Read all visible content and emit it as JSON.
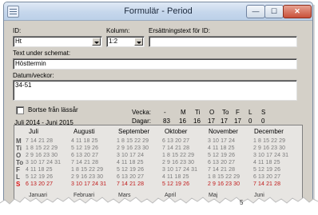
{
  "window": {
    "title": "Formulär - Period"
  },
  "controls": {
    "min": "—",
    "max": "☐",
    "close": "✕"
  },
  "fields": {
    "id_label": "ID:",
    "id_value": "Ht",
    "kolumn_label": "Kolumn:",
    "kolumn_value": "1:2",
    "ersattning_label": "Ersättningstext för ID:",
    "ersattning_value": "",
    "text_label": "Text under schemat:",
    "text_value": "Hösttermin",
    "datum_label": "Datum/veckor:",
    "datum_value": "34-51"
  },
  "checkbox": {
    "label": "Bortse från lässår"
  },
  "period_label": "Juli 2014 - Juni 2015",
  "summary": {
    "vecka_label": "Vecka:",
    "dagar_label": "Dagar:",
    "days": [
      "-",
      "M",
      "Ti",
      "O",
      "To",
      "F",
      "L",
      "S"
    ],
    "counts": [
      "83",
      "16",
      "16",
      "17",
      "17",
      "17",
      "0",
      "0"
    ]
  },
  "calendar": {
    "months": [
      "Juli",
      "Augusti",
      "September",
      "Oktober",
      "November",
      "December"
    ],
    "day_letters": [
      "M",
      "Ti",
      "O",
      "To",
      "F",
      "L",
      "S"
    ],
    "rows": [
      [
        "7 14 21 28",
        "4 11 18 25",
        "1 8 15 22 29",
        "6 13 20 27",
        "3 10 17 24",
        "1 8 15 22 29"
      ],
      [
        "1 8 15 22 29",
        "5 12 19 26",
        "2 9 16 23 30",
        "7 14 21 28",
        "4 11 18 25",
        "2 9 16 23 30"
      ],
      [
        "2 9 16 23 30",
        "6 13 20 27",
        "3 10 17 24",
        "1 8 15 22 29",
        "5 12 19 26",
        "3 10 17 24 31"
      ],
      [
        "3 10 17 24 31",
        "7 14 21 28",
        "4 11 18 25",
        "2 9 16 23 30",
        "6 13 20 27",
        "4 11 18 25"
      ],
      [
        "4 11 18 25",
        "1 8 15 22 29",
        "5 12 19 26",
        "3 10 17 24 31",
        "7 14 21 28",
        "5 12 19 26"
      ],
      [
        "5 12 19 26",
        "2 9 16 23 30",
        "6 13 20 27",
        "4 11 18 25",
        "1 8 15 22 29",
        "6 13 20 27"
      ],
      [
        "6 13 20 27",
        "3 10 17 24 31",
        "7 14 21 28",
        "5 12 19 26",
        "2 9 16 23 30",
        "7 14 21 28"
      ]
    ],
    "next_months": [
      "Januari",
      "Februari",
      "Mars",
      "April",
      "Maj",
      "Juni"
    ],
    "corner_number": "5"
  }
}
